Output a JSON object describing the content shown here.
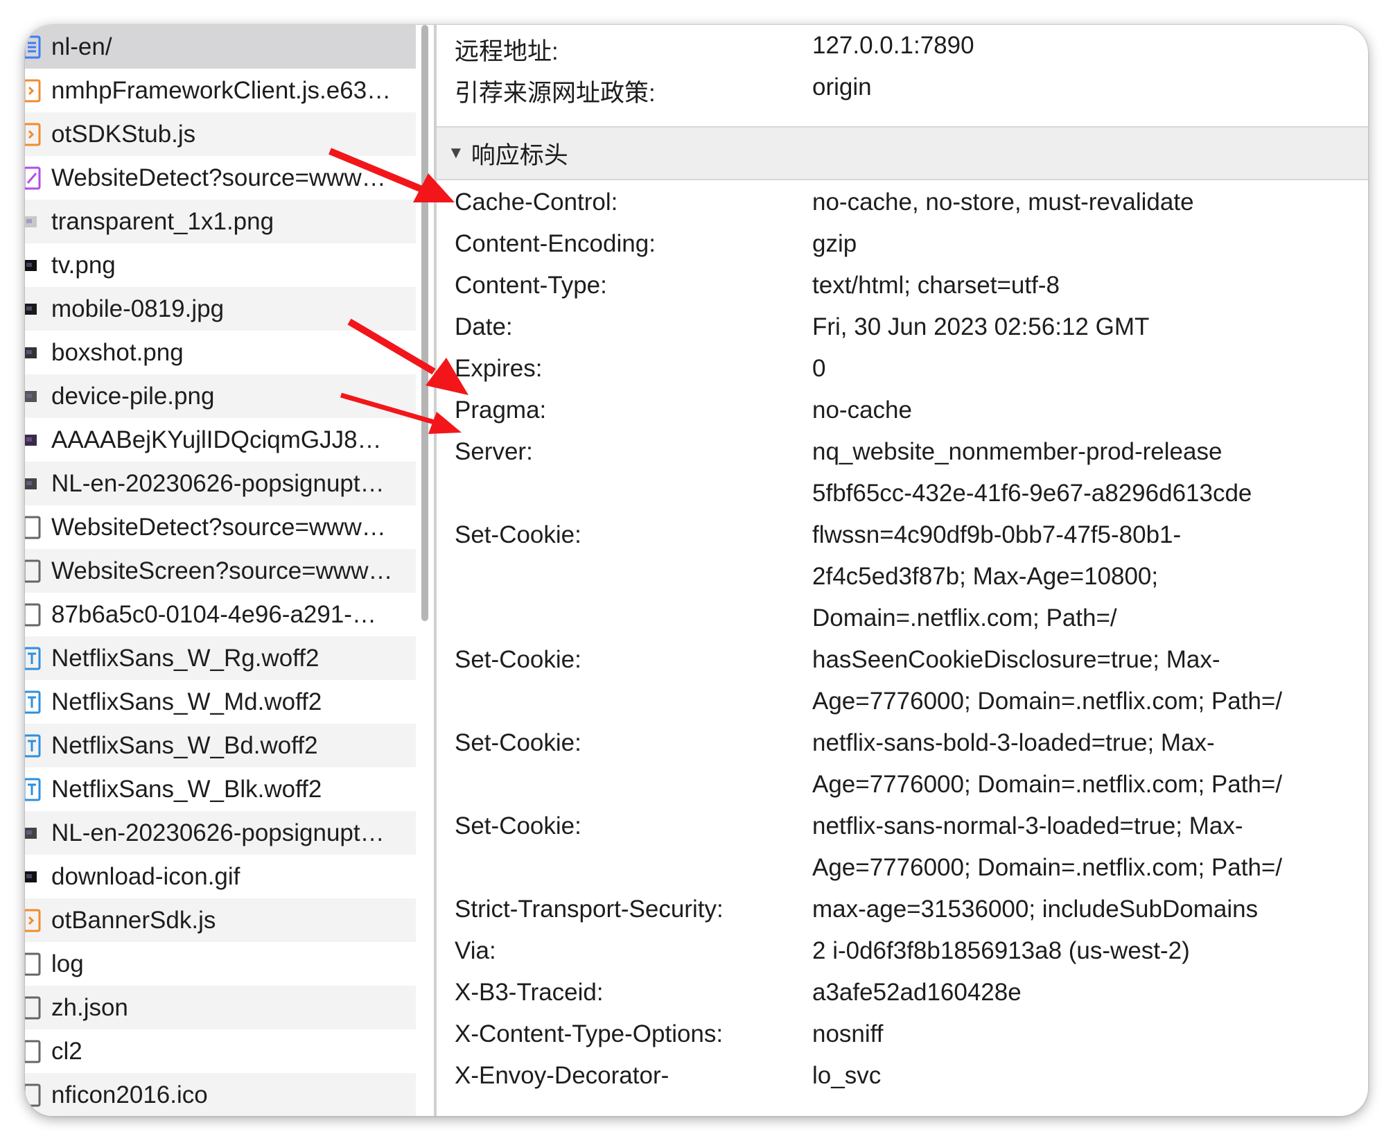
{
  "files": [
    {
      "name": "nl-en/",
      "icon": "document-icon",
      "color": "#3d7cf5"
    },
    {
      "name": "nmhpFrameworkClient.js.e63…",
      "icon": "script-icon",
      "color": "#f28b2c"
    },
    {
      "name": "otSDKStub.js",
      "icon": "script-icon",
      "color": "#f28b2c"
    },
    {
      "name": "WebsiteDetect?source=www…",
      "icon": "xhr-icon",
      "color": "#b24de5"
    },
    {
      "name": "transparent_1x1.png",
      "icon": "image-icon",
      "color": "#c8c8c8"
    },
    {
      "name": "tv.png",
      "icon": "image-icon",
      "color": "#111111"
    },
    {
      "name": "mobile-0819.jpg",
      "icon": "image-icon",
      "color": "#1a1a1a"
    },
    {
      "name": "boxshot.png",
      "icon": "image-icon",
      "color": "#333333"
    },
    {
      "name": "device-pile.png",
      "icon": "image-icon",
      "color": "#555555"
    },
    {
      "name": "AAAABejKYujlIDQciqmGJJ8…",
      "icon": "image-icon",
      "color": "#3a2a4a"
    },
    {
      "name": "NL-en-20230626-popsignupt…",
      "icon": "image-icon",
      "color": "#444444"
    },
    {
      "name": "WebsiteDetect?source=www…",
      "icon": "file-icon",
      "color": "#666666"
    },
    {
      "name": "WebsiteScreen?source=www…",
      "icon": "file-icon",
      "color": "#666666"
    },
    {
      "name": "87b6a5c0-0104-4e96-a291-…",
      "icon": "file-icon",
      "color": "#666666"
    },
    {
      "name": "NetflixSans_W_Rg.woff2",
      "icon": "font-icon",
      "color": "#2f8fdd"
    },
    {
      "name": "NetflixSans_W_Md.woff2",
      "icon": "font-icon",
      "color": "#2f8fdd"
    },
    {
      "name": "NetflixSans_W_Bd.woff2",
      "icon": "font-icon",
      "color": "#2f8fdd"
    },
    {
      "name": "NetflixSans_W_Blk.woff2",
      "icon": "font-icon",
      "color": "#2f8fdd"
    },
    {
      "name": "NL-en-20230626-popsignupt…",
      "icon": "image-icon",
      "color": "#444444"
    },
    {
      "name": "download-icon.gif",
      "icon": "image-icon",
      "color": "#111111"
    },
    {
      "name": "otBannerSdk.js",
      "icon": "script-icon",
      "color": "#f28b2c"
    },
    {
      "name": "log",
      "icon": "file-icon",
      "color": "#666666"
    },
    {
      "name": "zh.json",
      "icon": "file-icon",
      "color": "#666666"
    },
    {
      "name": "cl2",
      "icon": "file-icon",
      "color": "#666666"
    },
    {
      "name": "nficon2016.ico",
      "icon": "file-icon",
      "color": "#666666"
    }
  ],
  "general": [
    {
      "key": "远程地址:",
      "value": "127.0.0.1:7890"
    },
    {
      "key": "引荐来源网址政策:",
      "value": "origin"
    }
  ],
  "response_section": {
    "title": "响应标头",
    "toggle": "▼"
  },
  "response_headers": [
    {
      "key": "Cache-Control:",
      "lines": [
        "no-cache, no-store, must-revalidate"
      ]
    },
    {
      "key": "Content-Encoding:",
      "lines": [
        "gzip"
      ]
    },
    {
      "key": "Content-Type:",
      "lines": [
        "text/html; charset=utf-8"
      ]
    },
    {
      "key": "Date:",
      "lines": [
        "Fri, 30 Jun 2023 02:56:12 GMT"
      ]
    },
    {
      "key": "Expires:",
      "lines": [
        "0"
      ]
    },
    {
      "key": "Pragma:",
      "lines": [
        "no-cache"
      ]
    },
    {
      "key": "Server:",
      "lines": [
        "nq_website_nonmember-prod-release",
        "5fbf65cc-432e-41f6-9e67-a8296d613cde"
      ]
    },
    {
      "key": "Set-Cookie:",
      "lines": [
        "flwssn=4c90df9b-0bb7-47f5-80b1-",
        "2f4c5ed3f87b; Max-Age=10800;",
        "Domain=.netflix.com; Path=/"
      ]
    },
    {
      "key": "Set-Cookie:",
      "lines": [
        "hasSeenCookieDisclosure=true; Max-",
        "Age=7776000; Domain=.netflix.com; Path=/"
      ]
    },
    {
      "key": "Set-Cookie:",
      "lines": [
        "netflix-sans-bold-3-loaded=true; Max-",
        "Age=7776000; Domain=.netflix.com; Path=/"
      ]
    },
    {
      "key": "Set-Cookie:",
      "lines": [
        "netflix-sans-normal-3-loaded=true; Max-",
        "Age=7776000; Domain=.netflix.com; Path=/"
      ]
    },
    {
      "key": "Strict-Transport-Security:",
      "lines": [
        "max-age=31536000; includeSubDomains"
      ]
    },
    {
      "key": "Via:",
      "lines": [
        "2 i-0d6f3f8b1856913a8 (us-west-2)"
      ]
    },
    {
      "key": "X-B3-Traceid:",
      "lines": [
        "a3afe52ad160428e"
      ]
    },
    {
      "key": "X-Content-Type-Options:",
      "lines": [
        "nosniff"
      ]
    },
    {
      "key": "X-Envoy-Decorator-",
      "lines": [
        "lo_svc"
      ]
    }
  ],
  "annotation_color": "#f2161a"
}
